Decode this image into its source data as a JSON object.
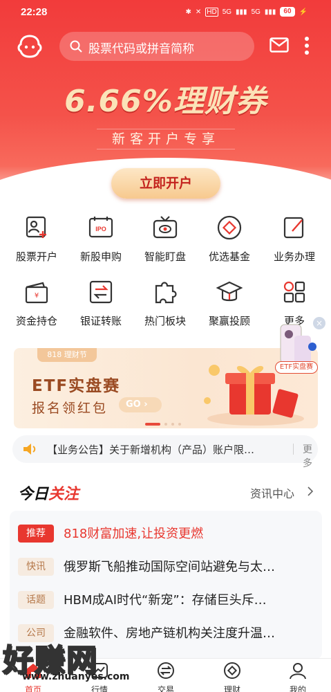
{
  "status_bar": {
    "time": "22:28",
    "network_1": "5G",
    "network_2": "5G",
    "hd": "HD",
    "battery": "60"
  },
  "header": {
    "search_placeholder": "股票代码或拼音简称"
  },
  "promo": {
    "title": "6.66%理财券",
    "subtitle": "新客开户专享",
    "button": "立即开户"
  },
  "grid": [
    {
      "label": "股票开户",
      "icon": "stock-account-icon"
    },
    {
      "label": "新股申购",
      "icon": "ipo-icon"
    },
    {
      "label": "智能盯盘",
      "icon": "smart-watch-icon"
    },
    {
      "label": "优选基金",
      "icon": "fund-icon"
    },
    {
      "label": "业务办理",
      "icon": "business-icon"
    },
    {
      "label": "资金持仓",
      "icon": "wallet-icon"
    },
    {
      "label": "银证转账",
      "icon": "transfer-icon"
    },
    {
      "label": "热门板块",
      "icon": "puzzle-icon"
    },
    {
      "label": "聚赢投顾",
      "icon": "advisor-icon"
    },
    {
      "label": "更多",
      "icon": "more-grid-icon"
    }
  ],
  "float_promo": {
    "label": "ETF实盘赛",
    "close": "×"
  },
  "banner": {
    "tag": "818 理财节",
    "title": "ETF实盘赛",
    "subtitle": "报名领红包",
    "go": "GO ›"
  },
  "notice": {
    "text": "【业务公告】关于新增机构（产品）账户限…",
    "more": "更多"
  },
  "focus": {
    "title_a": "今日",
    "title_b": "关注",
    "link": "资讯中心"
  },
  "news": [
    {
      "tag": "推荐",
      "text": "818财富加速,让投资更燃",
      "style": "red"
    },
    {
      "tag": "快讯",
      "text": "俄罗斯飞船推动国际空间站避免与太…",
      "style": "beige"
    },
    {
      "tag": "话题",
      "text": "HBM成AI时代“新宠”：存储巨头斥…",
      "style": "beige"
    },
    {
      "tag": "公司",
      "text": "金融软件、房地产链机构关注度升温…",
      "style": "beige"
    }
  ],
  "tabbar": [
    {
      "label": "首页",
      "icon": "home-icon",
      "active": true
    },
    {
      "label": "行情",
      "icon": "market-icon",
      "active": false
    },
    {
      "label": "交易",
      "icon": "trade-icon",
      "active": false
    },
    {
      "label": "理财",
      "icon": "finance-icon",
      "active": false
    },
    {
      "label": "我的",
      "icon": "profile-icon",
      "active": false
    }
  ],
  "watermark": {
    "big": "好赚网",
    "small": "www.zhuanyes.com"
  },
  "colors": {
    "brand_red": "#e8372f",
    "gold": "#f7c98e"
  }
}
